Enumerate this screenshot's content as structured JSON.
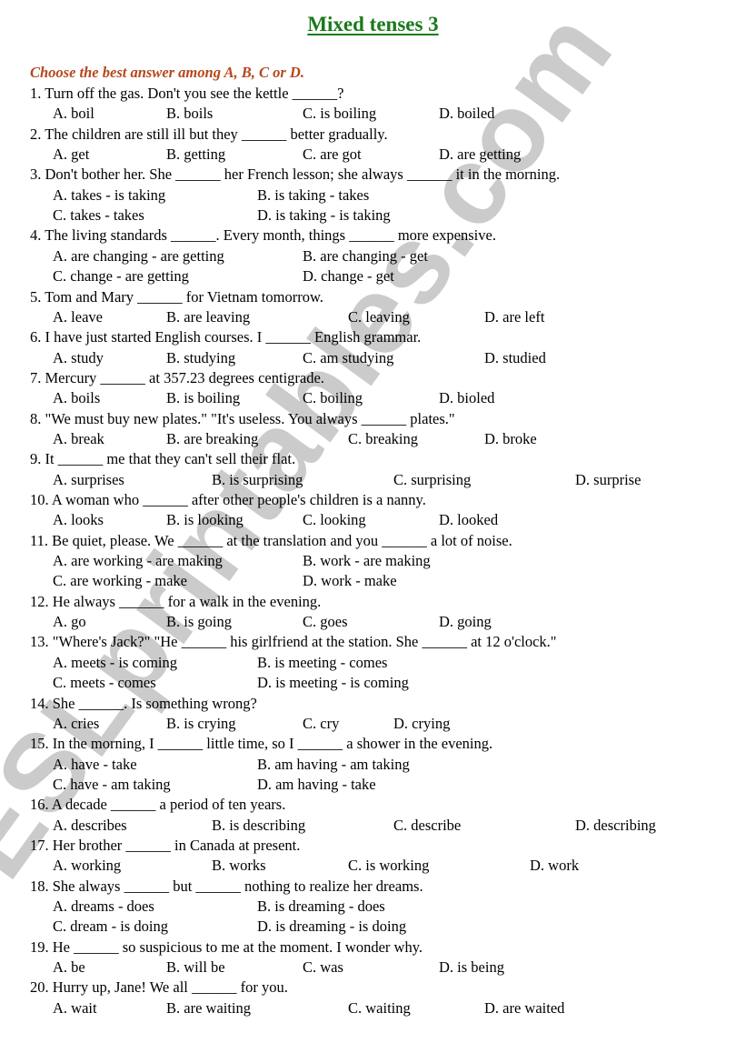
{
  "title": "Mixed tenses 3",
  "colors": {
    "title": "#1a7a1a",
    "instruction": "#b5471b",
    "watermark": "#a0a0a0"
  },
  "instruction": "Choose the best answer among A, B, C or D.",
  "watermark": "ESLprintables.com",
  "questions": [
    {
      "q": "1. Turn off the gas. Don't you see the kettle ______?",
      "options": [
        "A. boil",
        "B. boils",
        "C. is boiling",
        "D. boiled"
      ]
    },
    {
      "q": "2. The children are still ill but they ______ better gradually.",
      "options": [
        "A. get",
        "B. getting",
        "C. are got",
        "D. are getting"
      ]
    },
    {
      "q": "3. Don't bother her. She ______ her French lesson; she always ______ it in the morning.",
      "options": [
        "A. takes - is taking",
        "B. is taking - takes",
        "C. takes - takes",
        "D. is taking - is taking"
      ]
    },
    {
      "q": "4. The living standards ______. Every month, things ______ more expensive.",
      "options": [
        "A. are changing - are getting",
        "B. are changing - get",
        "C. change - are getting",
        "D. change - get"
      ]
    },
    {
      "q": "5. Tom and Mary ______ for Vietnam tomorrow.",
      "options": [
        "A. leave",
        "B. are leaving",
        "C. leaving",
        "D. are left"
      ]
    },
    {
      "q": "6. I have just started English courses. I ______ English grammar.",
      "options": [
        "A. study",
        "B. studying",
        "C. am studying",
        "D. studied"
      ]
    },
    {
      "q": "7. Mercury ______ at 357.23 degrees centigrade.",
      "options": [
        "A. boils",
        "B. is boiling",
        "C. boiling",
        "D. bioled"
      ]
    },
    {
      "q": "8. \"We must buy new plates.\" \"It's useless. You always ______ plates.\"",
      "options": [
        "A. break",
        "B. are breaking",
        "C. breaking",
        "D. broke"
      ]
    },
    {
      "q": "9. It ______ me that they can't sell their flat.",
      "options": [
        "A. surprises",
        "B. is surprising",
        "C. surprising",
        "D. surprise"
      ]
    },
    {
      "q": "10. A woman who ______ after other people's children is a nanny.",
      "options": [
        "A. looks",
        "B. is looking",
        "C. looking",
        "D. looked"
      ]
    },
    {
      "q": "11. Be quiet, please. We ______ at the translation and you ______ a lot of noise.",
      "options": [
        "A. are working - are making",
        "B. work - are making",
        "C. are working - make",
        "D. work - make"
      ]
    },
    {
      "q": "12. He always ______ for a walk in the evening.",
      "options": [
        "A. go",
        "B. is going",
        "C. goes",
        "D. going"
      ]
    },
    {
      "q": "13. \"Where's Jack?\" \"He ______ his girlfriend at the station. She ______ at 12 o'clock.\"",
      "options": [
        "A. meets - is coming",
        "B. is meeting - comes",
        "C. meets - comes",
        "D. is meeting - is coming"
      ]
    },
    {
      "q": "14. She ______. Is something wrong?",
      "options": [
        "A. cries",
        "B. is crying",
        "C. cry",
        "D. crying"
      ]
    },
    {
      "q": "15. In the morning, I ______ little time, so I ______ a shower in the evening.",
      "options": [
        "A. have - take",
        "B. am having - am taking",
        "C. have - am taking",
        "D. am having - take"
      ]
    },
    {
      "q": "16. A decade ______ a period of ten years.",
      "options": [
        "A. describes",
        "B. is describing",
        "C. describe",
        "D. describing"
      ]
    },
    {
      "q": "17. Her brother ______ in Canada at present.",
      "options": [
        "A. working",
        "B. works",
        "C. is working",
        "D. work"
      ]
    },
    {
      "q": "18. She always ______ but ______ nothing to realize her dreams.",
      "options": [
        "A. dreams - does",
        "B. is dreaming - does",
        "C. dream - is doing",
        "D. is dreaming - is doing"
      ]
    },
    {
      "q": "19. He ______ so suspicious to me at the moment. I wonder why.",
      "options": [
        "A. be",
        "B. will be",
        "C. was",
        "D. is being"
      ]
    },
    {
      "q": "20. Hurry up, Jane! We all ______ for you.",
      "options": [
        "A. wait",
        "B. are waiting",
        "C. waiting",
        "D. are waited"
      ]
    }
  ]
}
